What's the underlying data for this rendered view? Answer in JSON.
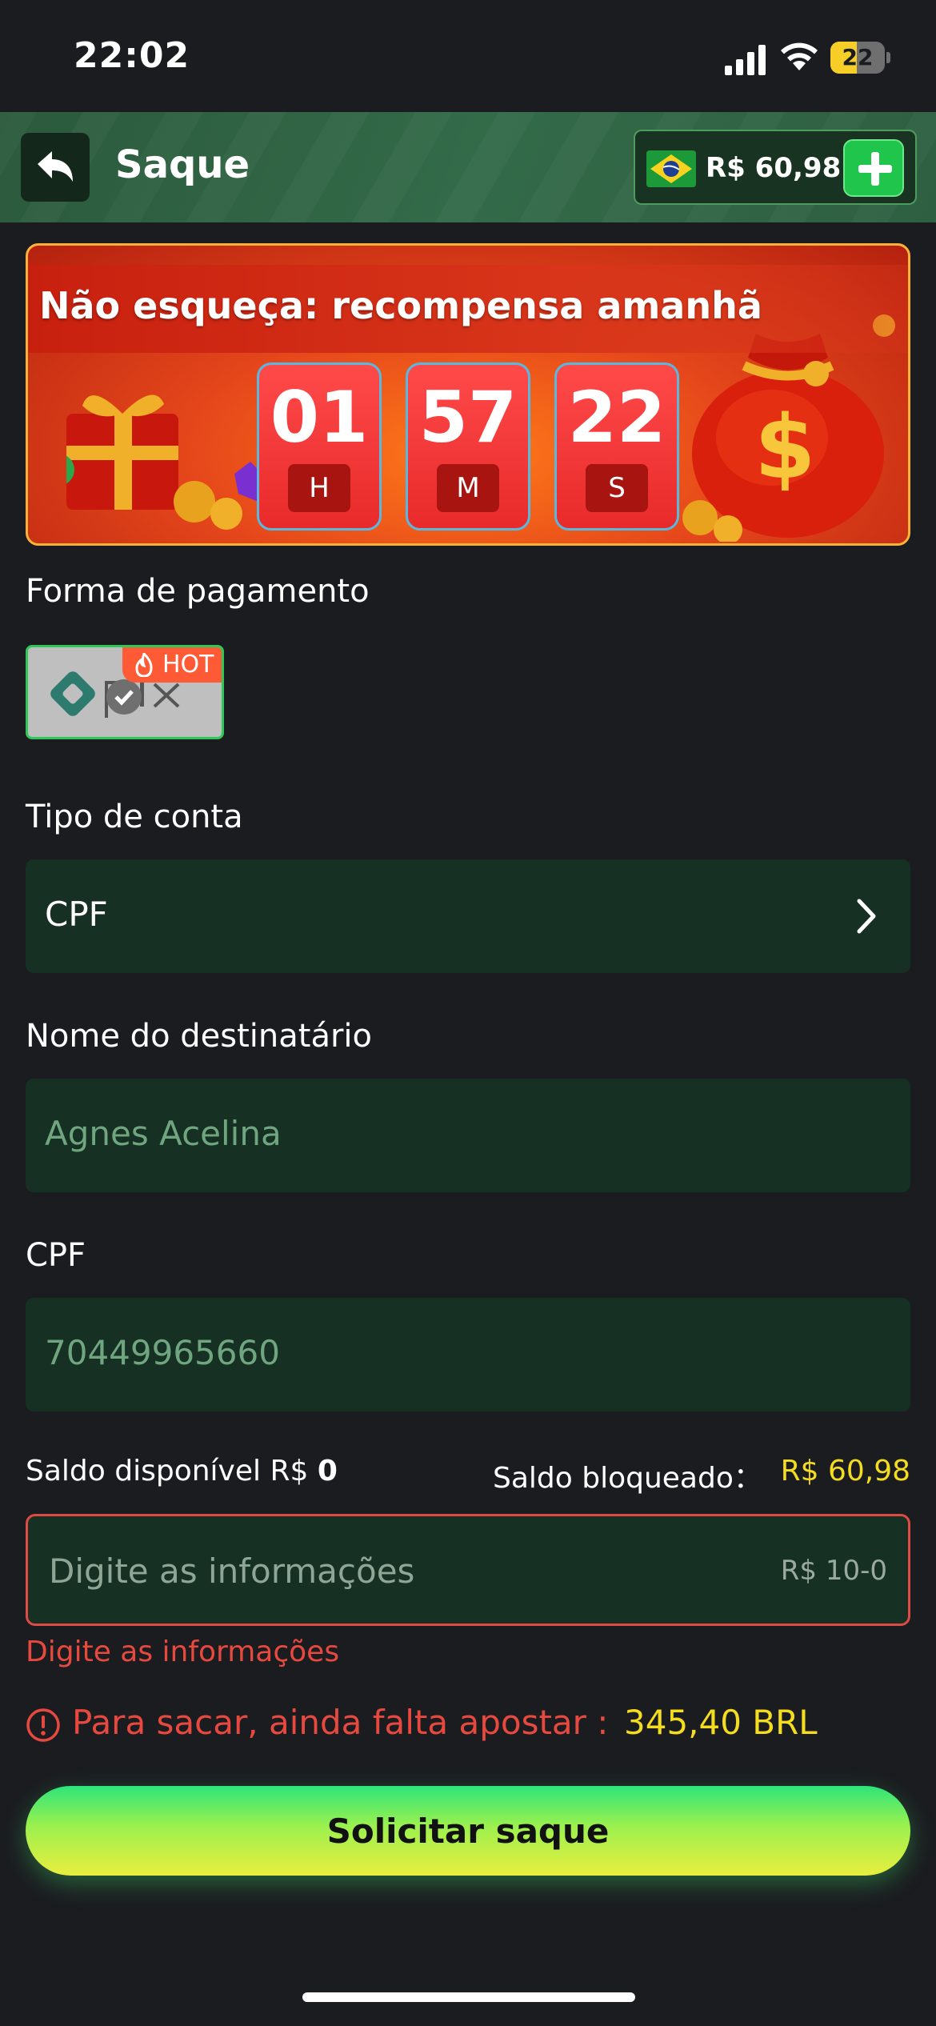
{
  "status_bar": {
    "time": "22:02",
    "battery": "22",
    "battery_percent": 22
  },
  "header": {
    "title": "Saque",
    "balance": "R$ 60,98",
    "accent_color": "#20c54b"
  },
  "promo": {
    "title": "Não esqueça: recompensa amanhã",
    "countdown": [
      {
        "value": "01",
        "unit": "H"
      },
      {
        "value": "57",
        "unit": "M"
      },
      {
        "value": "22",
        "unit": "S"
      }
    ]
  },
  "payment": {
    "label": "Forma de pagamento",
    "method": "pix",
    "badge": "HOT"
  },
  "account_type": {
    "label": "Tipo de conta",
    "value": "CPF"
  },
  "recipient": {
    "label": "Nome do destinatário",
    "placeholder": "Agnes Acelina"
  },
  "cpf": {
    "label": "CPF",
    "placeholder": "70449965660"
  },
  "balances": {
    "available_label": "Saldo disponível R$",
    "available_value": "0",
    "blocked_label": "Saldo bloqueado：",
    "blocked_value": "R$ 60,98"
  },
  "amount": {
    "placeholder": "Digite as informações",
    "range": "R$ 10-0",
    "error": "Digite as informações"
  },
  "warning": {
    "text": "Para sacar, ainda falta apostar :",
    "amount": "345,40 BRL"
  },
  "submit_label": "Solicitar saque"
}
